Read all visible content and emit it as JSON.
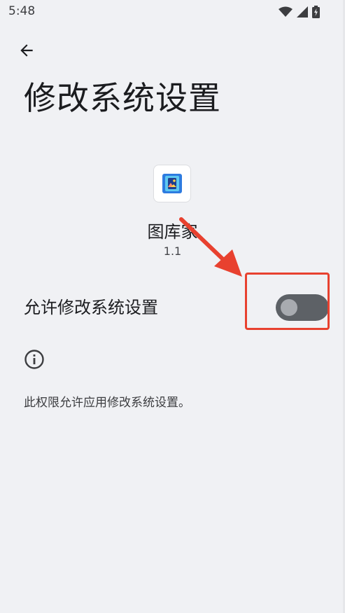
{
  "status_bar": {
    "time": "5:48"
  },
  "header": {
    "title": "修改系统设置"
  },
  "app": {
    "name": "图库家",
    "version": "1.1"
  },
  "setting": {
    "label": "允许修改系统设置",
    "toggle_on": false
  },
  "info": {
    "description": "此权限允许应用修改系统设置。"
  },
  "annotation_color": "#e8412f",
  "icons": [
    "back-arrow-icon",
    "wifi-icon",
    "signal-icon",
    "battery-icon",
    "info-icon",
    "gallery-app-icon"
  ]
}
